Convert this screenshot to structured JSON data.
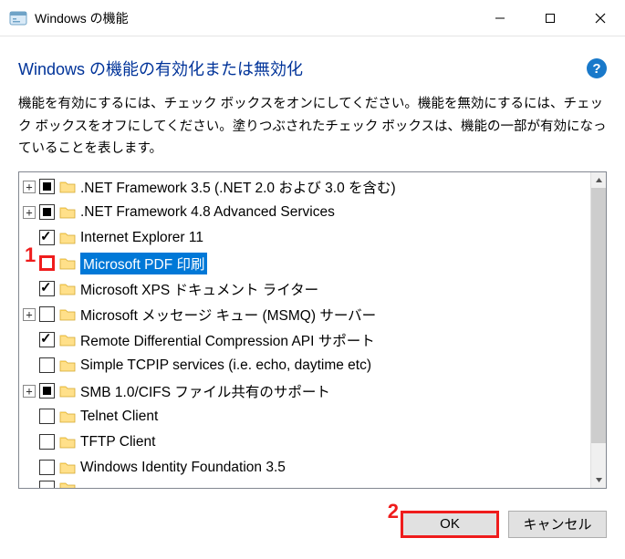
{
  "window": {
    "title": "Windows の機能"
  },
  "header": {
    "heading": "Windows の機能の有効化または無効化",
    "help_glyph": "?",
    "description": "機能を有効にするには、チェック ボックスをオンにしてください。機能を無効にするには、チェック ボックスをオフにしてください。塗りつぶされたチェック ボックスは、機能の一部が有効になっていることを表します。"
  },
  "annotations": {
    "n1": "1",
    "n2": "2"
  },
  "tree": {
    "items": [
      {
        "expand": "plus",
        "check": "filled",
        "label": ".NET Framework 3.5 (.NET 2.0 および 3.0 を含む)",
        "selected": false
      },
      {
        "expand": "plus",
        "check": "filled",
        "label": ".NET Framework 4.8 Advanced Services",
        "selected": false
      },
      {
        "expand": "none",
        "check": "checked",
        "label": "Internet Explorer 11",
        "selected": false
      },
      {
        "expand": "none",
        "check": "empty-red",
        "label": "Microsoft PDF 印刷",
        "selected": true
      },
      {
        "expand": "none",
        "check": "checked",
        "label": "Microsoft XPS ドキュメント ライター",
        "selected": false
      },
      {
        "expand": "plus",
        "check": "empty",
        "label": "Microsoft メッセージ キュー (MSMQ) サーバー",
        "selected": false
      },
      {
        "expand": "none",
        "check": "checked",
        "label": "Remote Differential Compression API サポート",
        "selected": false
      },
      {
        "expand": "none",
        "check": "empty",
        "label": "Simple TCPIP services (i.e. echo, daytime etc)",
        "selected": false
      },
      {
        "expand": "plus",
        "check": "filled",
        "label": "SMB 1.0/CIFS ファイル共有のサポート",
        "selected": false
      },
      {
        "expand": "none",
        "check": "empty",
        "label": "Telnet Client",
        "selected": false
      },
      {
        "expand": "none",
        "check": "empty",
        "label": "TFTP Client",
        "selected": false
      },
      {
        "expand": "none",
        "check": "empty",
        "label": "Windows Identity Foundation 3.5",
        "selected": false
      }
    ]
  },
  "buttons": {
    "ok": "OK",
    "cancel": "キャンセル"
  }
}
